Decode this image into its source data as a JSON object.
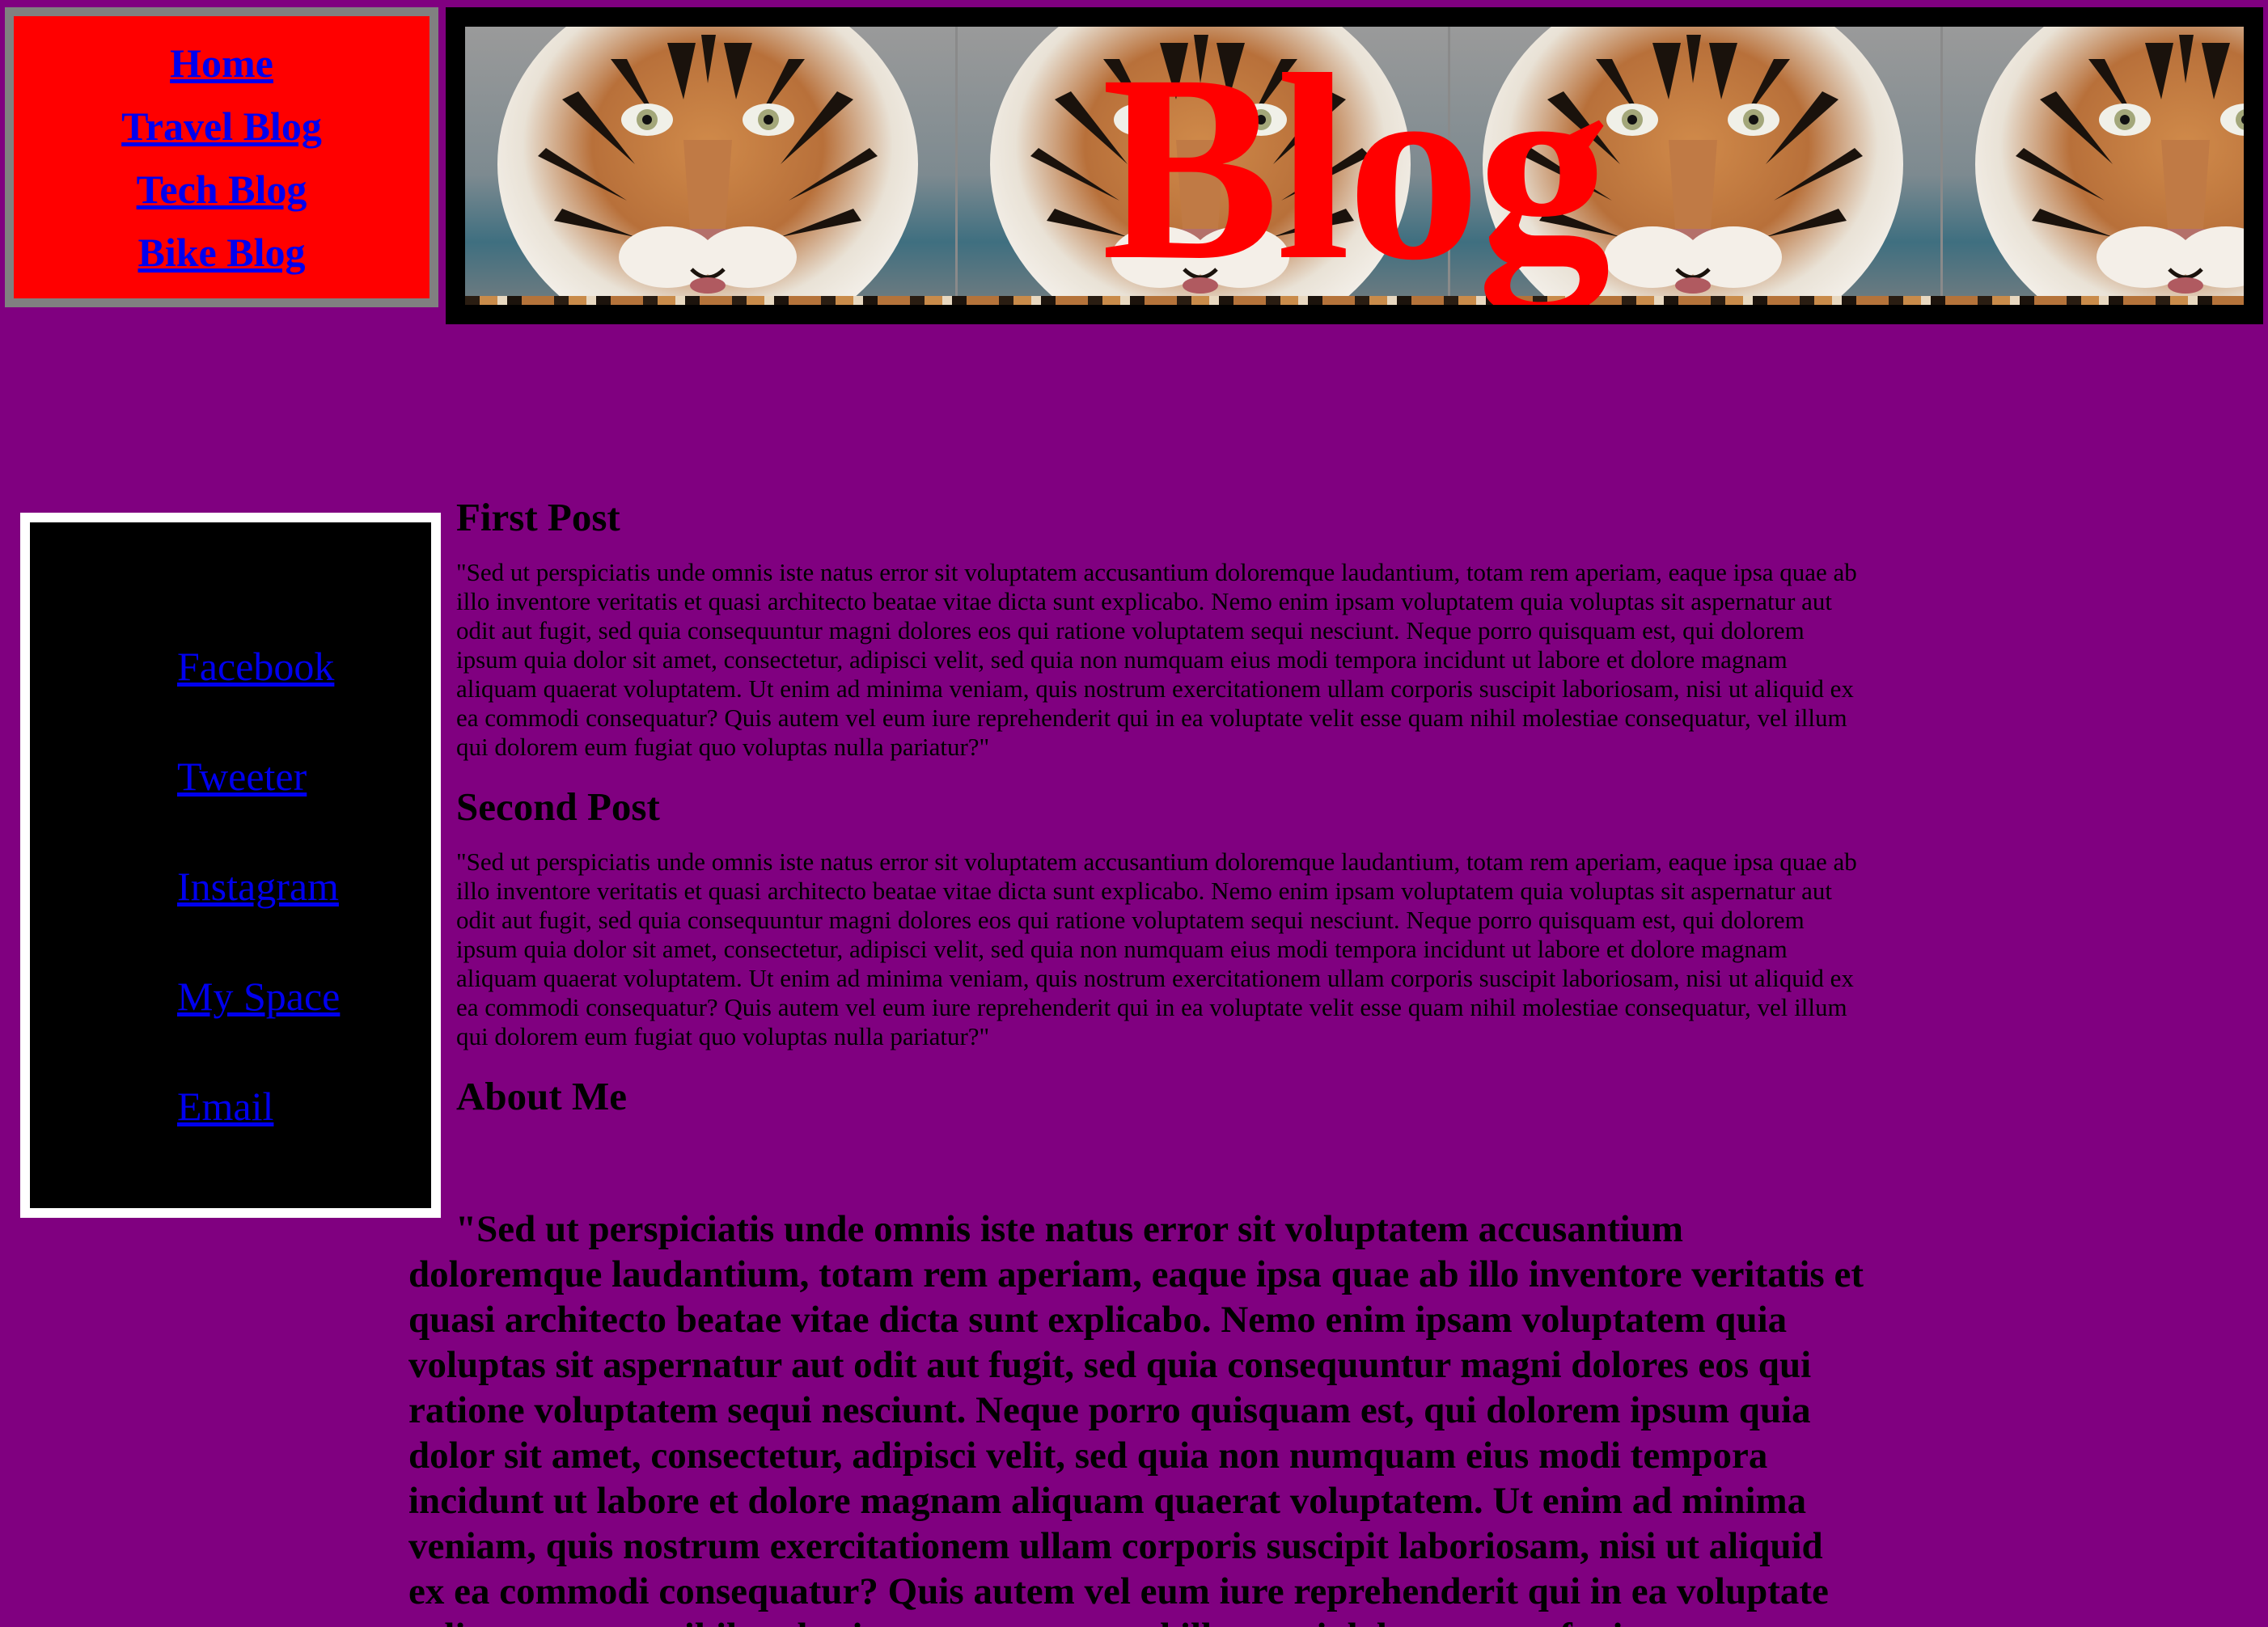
{
  "nav": {
    "links": [
      "Home",
      "Travel Blog",
      "Tech Blog",
      "Bike Blog"
    ]
  },
  "banner": {
    "title": "Blog",
    "image": "tiger-face-tiled-image"
  },
  "social": {
    "links": [
      "Facebook",
      "Tweeter",
      "Instagram",
      "My Space",
      "Email"
    ]
  },
  "posts": [
    {
      "title": "First Post",
      "body": "\"Sed ut perspiciatis unde omnis iste natus error sit voluptatem accusantium doloremque laudantium, totam rem aperiam, eaque ipsa quae ab illo inventore veritatis et quasi architecto beatae vitae dicta sunt explicabo. Nemo enim ipsam voluptatem quia voluptas sit aspernatur aut odit aut fugit, sed quia consequuntur magni dolores eos qui ratione voluptatem sequi nesciunt. Neque porro quisquam est, qui dolorem ipsum quia dolor sit amet, consectetur, adipisci velit, sed quia non numquam eius modi tempora incidunt ut labore et dolore magnam aliquam quaerat voluptatem. Ut enim ad minima veniam, quis nostrum exercitationem ullam corporis suscipit laboriosam, nisi ut aliquid ex ea commodi consequatur? Quis autem vel eum iure reprehenderit qui in ea voluptate velit esse quam nihil molestiae consequatur, vel illum qui dolorem eum fugiat quo voluptas nulla pariatur?\""
    },
    {
      "title": "Second Post",
      "body": "\"Sed ut perspiciatis unde omnis iste natus error sit voluptatem accusantium doloremque laudantium, totam rem aperiam, eaque ipsa quae ab illo inventore veritatis et quasi architecto beatae vitae dicta sunt explicabo. Nemo enim ipsam voluptatem quia voluptas sit aspernatur aut odit aut fugit, sed quia consequuntur magni dolores eos qui ratione voluptatem sequi nesciunt. Neque porro quisquam est, qui dolorem ipsum quia dolor sit amet, consectetur, adipisci velit, sed quia non numquam eius modi tempora incidunt ut labore et dolore magnam aliquam quaerat voluptatem. Ut enim ad minima veniam, quis nostrum exercitationem ullam corporis suscipit laboriosam, nisi ut aliquid ex ea commodi consequatur? Quis autem vel eum iure reprehenderit qui in ea voluptate velit esse quam nihil molestiae consequatur, vel illum qui dolorem eum fugiat quo voluptas nulla pariatur?\""
    }
  ],
  "about": {
    "title": "About Me",
    "body": "\"Sed ut perspiciatis unde omnis iste natus error sit voluptatem accusantium doloremque laudantium, totam rem aperiam, eaque ipsa quae ab illo inventore veritatis et quasi architecto beatae vitae dicta sunt explicabo. Nemo enim ipsam voluptatem quia voluptas sit aspernatur aut odit aut fugit, sed quia consequuntur magni dolores eos qui ratione voluptatem sequi nesciunt. Neque porro quisquam est, qui dolorem ipsum quia dolor sit amet, consectetur, adipisci velit, sed quia non numquam eius modi tempora incidunt ut labore et dolore magnam aliquam quaerat voluptatem. Ut enim ad minima veniam, quis nostrum exercitationem ullam corporis suscipit laboriosam, nisi ut aliquid ex ea commodi consequatur? Quis autem vel eum iure reprehenderit qui in ea voluptate velit esse quam nihil molestiae consequatur, vel illum qui dolorem eum fugiat quo voluptas nulla pariatur?\""
  },
  "colors": {
    "page_background": "#800080",
    "nav_background": "#ff0000",
    "nav_border": "#808080",
    "banner_title": "#ff0000",
    "social_background": "#000000",
    "social_border": "#ffffff",
    "link": "#0000ee"
  }
}
